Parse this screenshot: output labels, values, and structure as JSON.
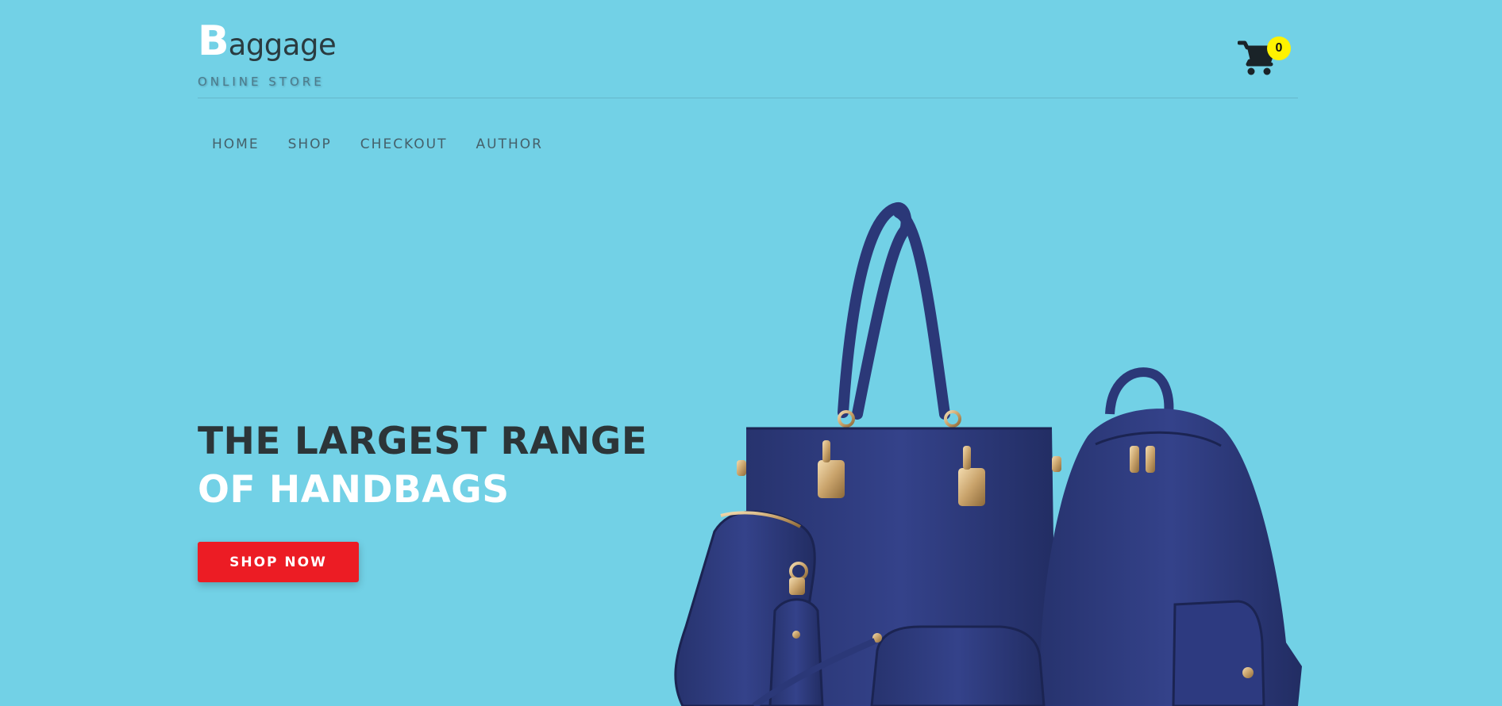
{
  "brand": {
    "logo_initial": "B",
    "logo_rest": "aggage",
    "tagline": "ONLINE STORE"
  },
  "cart": {
    "icon": "shopping-cart-icon",
    "count": "0",
    "badge_color": "#fff200"
  },
  "nav": {
    "items": [
      {
        "label": "HOME"
      },
      {
        "label": "SHOP"
      },
      {
        "label": "CHECKOUT"
      },
      {
        "label": "AUTHOR"
      }
    ]
  },
  "hero": {
    "title_line1": "THE LARGEST RANGE",
    "title_line2": "OF HANDBAGS",
    "cta_label": "SHOP NOW",
    "image": "navy-handbag-set-illustration"
  },
  "colors": {
    "background": "#72d1e6",
    "accent": "#ec1c24",
    "bag": "#2b3878"
  }
}
